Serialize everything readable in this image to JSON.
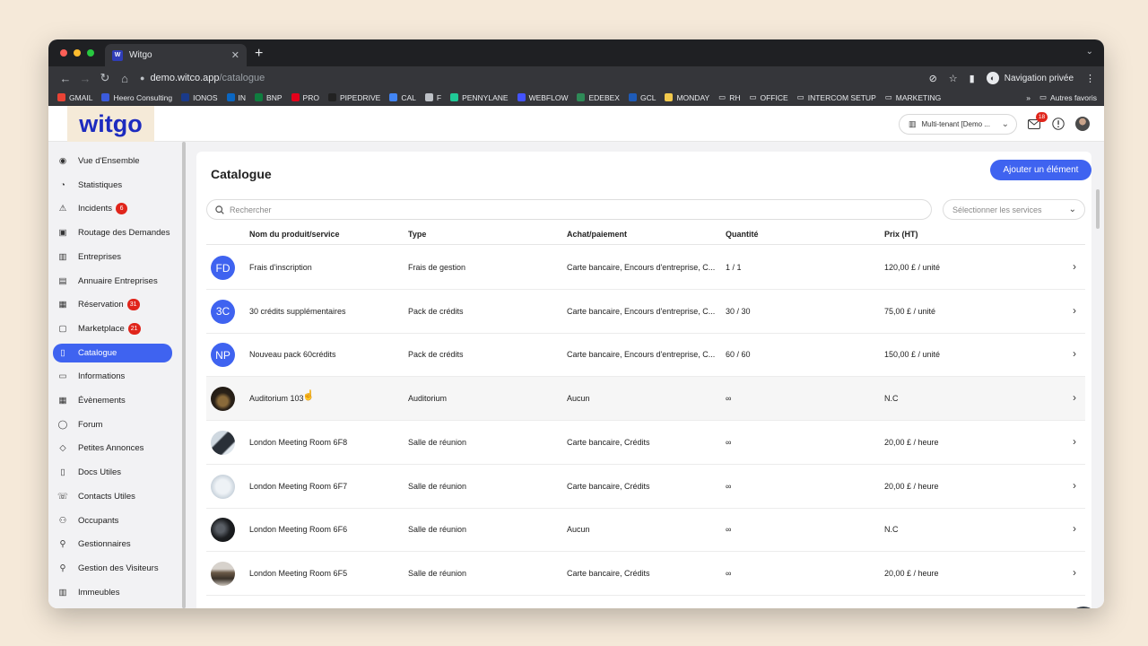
{
  "browser": {
    "tab_title": "Witgo",
    "url_host": "demo.witco.app",
    "url_path": "/catalogue",
    "incognito_label": "Navigation privée",
    "bookmarks": [
      {
        "label": "GMAIL",
        "color": "#ea4335"
      },
      {
        "label": "Heero Consulting",
        "color": "#3b5bdb"
      },
      {
        "label": "IONOS",
        "color": "#1a3a8a"
      },
      {
        "label": "IN",
        "color": "#0a66c2"
      },
      {
        "label": "BNP",
        "color": "#0f7d3f"
      },
      {
        "label": "PRO",
        "color": "#e3001b"
      },
      {
        "label": "PIPEDRIVE",
        "color": "#222222"
      },
      {
        "label": "CAL",
        "color": "#4285f4"
      },
      {
        "label": "F",
        "color": "#bdc1c6"
      },
      {
        "label": "PENNYLANE",
        "color": "#20c997"
      },
      {
        "label": "WEBFLOW",
        "color": "#4353ff"
      },
      {
        "label": "EDEBEX",
        "color": "#2e8b57"
      },
      {
        "label": "GCL",
        "color": "#1e5bb8"
      },
      {
        "label": "MONDAY",
        "color": "#f2c94c"
      },
      {
        "label": "RH",
        "color": "folder"
      },
      {
        "label": "OFFICE",
        "color": "folder"
      },
      {
        "label": "INTERCOM SETUP",
        "color": "folder"
      },
      {
        "label": "MARKETING",
        "color": "folder"
      }
    ],
    "overflow": "»",
    "other_bookmarks": "Autres favoris"
  },
  "header": {
    "logo_text": "witgo",
    "tenant_label": "Multi-tenant [Demo ...",
    "notification_count": "18"
  },
  "sidebar": {
    "items": [
      {
        "label": "Vue d'Ensemble",
        "icon": "eye-icon",
        "glyph": "◉"
      },
      {
        "label": "Statistiques",
        "icon": "pie-chart-icon",
        "glyph": "◔"
      },
      {
        "label": "Incidents",
        "icon": "warning-icon",
        "glyph": "⚠",
        "badge": "6"
      },
      {
        "label": "Routage des Demandes",
        "icon": "routing-icon",
        "glyph": "▣"
      },
      {
        "label": "Entreprises",
        "icon": "buildings-icon",
        "glyph": "▥"
      },
      {
        "label": "Annuaire Entreprises",
        "icon": "directory-icon",
        "glyph": "▤"
      },
      {
        "label": "Réservation",
        "icon": "calendar-icon",
        "glyph": "▦",
        "badge": "31"
      },
      {
        "label": "Marketplace",
        "icon": "shop-icon",
        "glyph": "▢",
        "badge": "21"
      },
      {
        "label": "Catalogue",
        "icon": "catalogue-icon",
        "glyph": "▯",
        "active": true
      },
      {
        "label": "Informations",
        "icon": "info-icon",
        "glyph": "▭"
      },
      {
        "label": "Évènements",
        "icon": "event-icon",
        "glyph": "▦"
      },
      {
        "label": "Forum",
        "icon": "chat-icon",
        "glyph": "◯"
      },
      {
        "label": "Petites Annonces",
        "icon": "tag-icon",
        "glyph": "◇"
      },
      {
        "label": "Docs Utiles",
        "icon": "document-icon",
        "glyph": "▯"
      },
      {
        "label": "Contacts Utiles",
        "icon": "phone-icon",
        "glyph": "☏"
      },
      {
        "label": "Occupants",
        "icon": "users-icon",
        "glyph": "⚇"
      },
      {
        "label": "Gestionnaires",
        "icon": "user-icon",
        "glyph": "⚲"
      },
      {
        "label": "Gestion des Visiteurs",
        "icon": "visitor-icon",
        "glyph": "⚲"
      },
      {
        "label": "Immeubles",
        "icon": "building-icon",
        "glyph": "▥"
      }
    ]
  },
  "main": {
    "title": "Catalogue",
    "add_button": "Ajouter un élément",
    "search_placeholder": "Rechercher",
    "services_placeholder": "Sélectionner les services",
    "columns": [
      "Nom du produit/service",
      "Type",
      "Achat/paiement",
      "Quantité",
      "Prix (HT)"
    ],
    "rows": [
      {
        "avatar": "FD",
        "avatar_type": "init",
        "name": "Frais d'inscription",
        "type": "Frais de gestion",
        "payment": "Carte bancaire, Encours d'entreprise, C...",
        "quantity": "1 / 1",
        "price": "120,00 £ / unité"
      },
      {
        "avatar": "3C",
        "avatar_type": "init",
        "name": "30 crédits supplémentaires",
        "type": "Pack de crédits",
        "payment": "Carte bancaire, Encours d'entreprise, C...",
        "quantity": "30 / 30",
        "price": "75,00 £ / unité"
      },
      {
        "avatar": "NP",
        "avatar_type": "init",
        "name": "Nouveau pack 60crédits",
        "type": "Pack de crédits",
        "payment": "Carte bancaire, Encours d'entreprise, C...",
        "quantity": "60 / 60",
        "price": "150,00 £ / unité"
      },
      {
        "avatar": "",
        "avatar_type": "photo1",
        "name": "Auditorium 103",
        "type": "Auditorium",
        "payment": "Aucun",
        "quantity": "∞",
        "price": "N.C",
        "hover": true
      },
      {
        "avatar": "",
        "avatar_type": "photo2",
        "name": "London Meeting Room 6F8",
        "type": "Salle de réunion",
        "payment": "Carte bancaire, Crédits",
        "quantity": "∞",
        "price": "20,00 £ / heure"
      },
      {
        "avatar": "",
        "avatar_type": "photo3",
        "name": "London Meeting Room 6F7",
        "type": "Salle de réunion",
        "payment": "Carte bancaire, Crédits",
        "quantity": "∞",
        "price": "20,00 £ / heure"
      },
      {
        "avatar": "",
        "avatar_type": "photo4",
        "name": "London Meeting Room 6F6",
        "type": "Salle de réunion",
        "payment": "Aucun",
        "quantity": "∞",
        "price": "N.C"
      },
      {
        "avatar": "",
        "avatar_type": "photo5",
        "name": "London Meeting Room 6F5",
        "type": "Salle de réunion",
        "payment": "Carte bancaire, Crédits",
        "quantity": "∞",
        "price": "20,00 £ / heure"
      }
    ]
  },
  "help_label": "?"
}
